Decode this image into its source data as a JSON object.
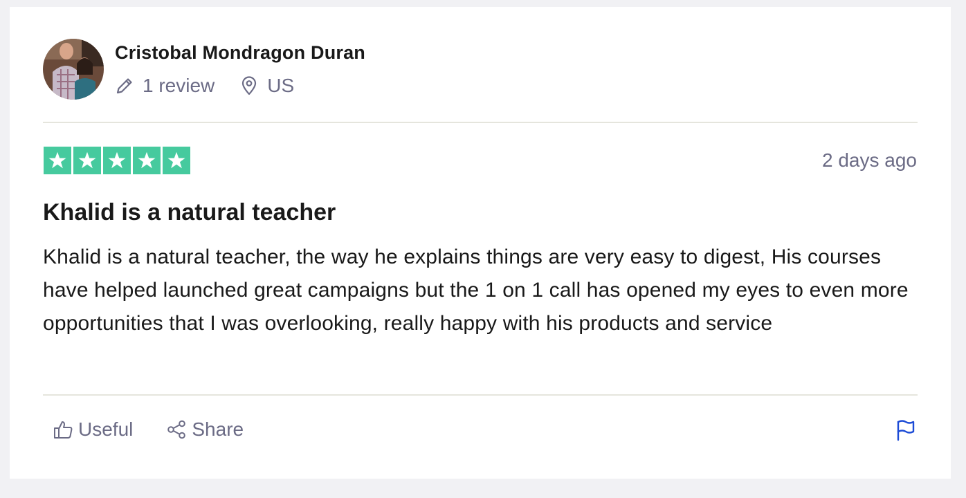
{
  "reviewer": {
    "name": "Cristobal Mondragon Duran",
    "review_count": "1 review",
    "country": "US"
  },
  "review": {
    "rating": 5,
    "rating_max": 5,
    "star_color": "#00b67a",
    "date": "2 days ago",
    "title": "Khalid is a natural teacher",
    "body": "Khalid is a natural teacher, the way he explains things are very easy to digest, His courses have helped launched great campaigns but the 1 on 1 call has opened my eyes to even more opportunities that I was overlooking, really happy with his products and service"
  },
  "actions": {
    "useful_label": "Useful",
    "share_label": "Share",
    "flag_icon": "flag-icon",
    "flag_color": "#1c4bd6"
  },
  "icons": {
    "review_count": "pencil-icon",
    "country": "location-pin-icon",
    "useful": "thumbs-up-icon",
    "share": "share-icon"
  }
}
